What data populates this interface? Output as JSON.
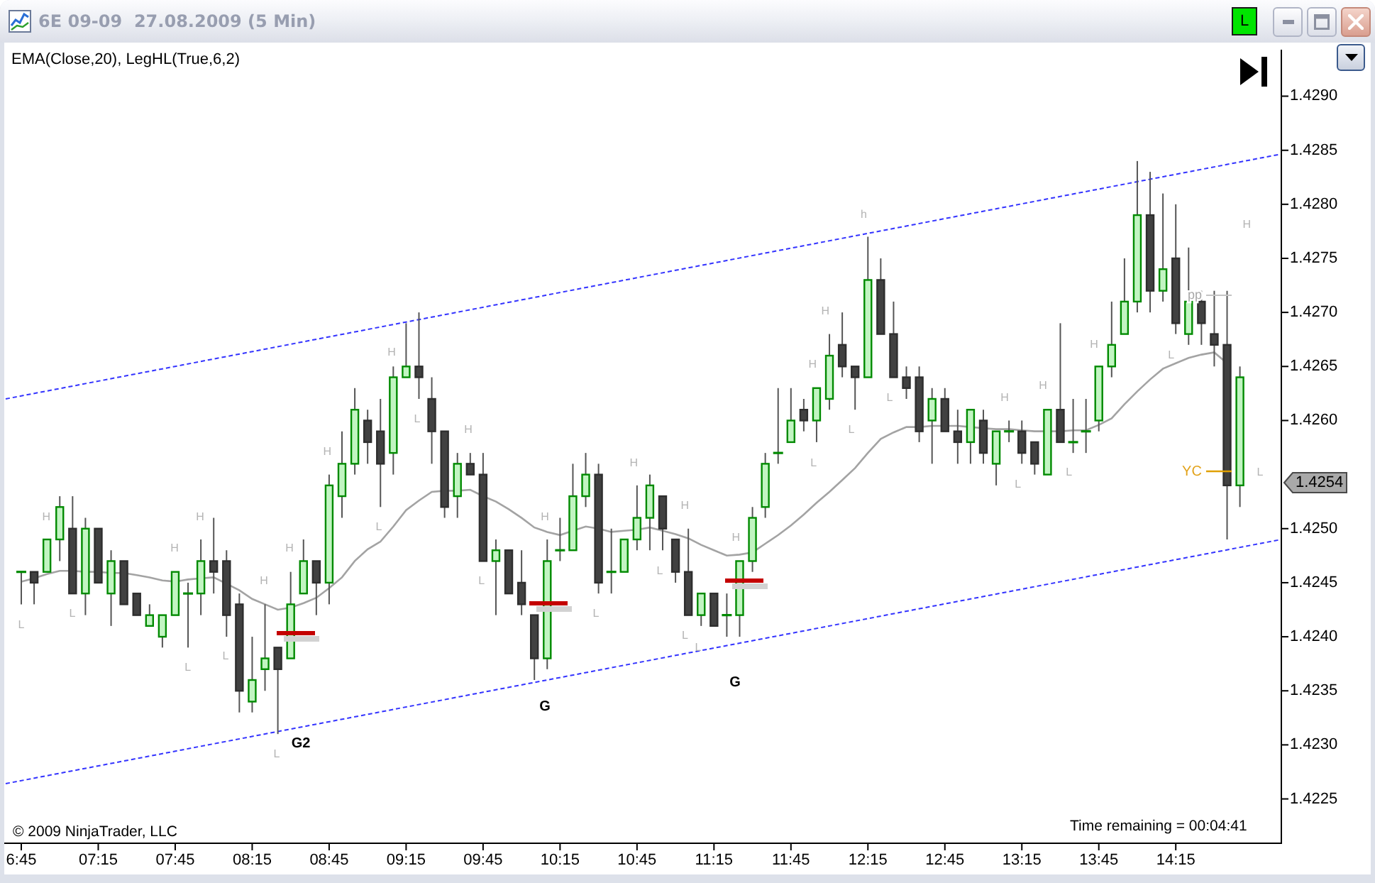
{
  "window": {
    "title": "6E 09-09  27.08.2009 (5 Min)",
    "status_badge": "L"
  },
  "chart": {
    "other_indicators": ", LegHL(True,6,2)",
    "leg_labels": [
      "L",
      "H",
      "L",
      "H",
      "L",
      "H",
      "L",
      "H",
      "L",
      "H",
      "H",
      "L",
      "H",
      "L",
      "H",
      "L",
      "H",
      "L",
      "H",
      "L",
      "H",
      "L",
      "L",
      "H",
      "H",
      "L",
      "H",
      "L",
      "h",
      "L",
      "H",
      "L",
      "H",
      "L",
      "H",
      "L",
      "H",
      "L"
    ],
    "signal_labels": [
      "G2",
      "G",
      "G"
    ],
    "yc_label": "YC",
    "pp_label": "pp",
    "last_price": "1.4254",
    "copyright": "© 2009 NinjaTrader, LLC",
    "time_remaining": "Time remaining = 00:04:41",
    "chart_data": {
      "type": "candlestick",
      "categories": [
        "6:45",
        null,
        null,
        null,
        null,
        null,
        "07:15",
        null,
        null,
        null,
        null,
        null,
        "07:45",
        null,
        null,
        null,
        null,
        null,
        "08:15",
        null,
        null,
        null,
        null,
        null,
        "08:45",
        null,
        null,
        null,
        null,
        null,
        "09:15",
        null,
        null,
        null,
        null,
        null,
        "09:45",
        null,
        null,
        null,
        null,
        null,
        "10:15",
        null,
        null,
        null,
        null,
        null,
        "10:45",
        null,
        null,
        null,
        null,
        null,
        "11:15",
        null,
        null,
        null,
        null,
        null,
        "11:45",
        null,
        null,
        null,
        null,
        null,
        "12:15",
        null,
        null,
        null,
        null,
        null,
        "12:45",
        null,
        null,
        null,
        null,
        null,
        "13:15",
        null,
        null,
        null,
        null,
        null,
        "13:45",
        null,
        null,
        null,
        null,
        null,
        "14:15",
        null,
        null,
        null,
        null,
        null
      ],
      "ohlc": [
        [
          1.4246,
          1.4246,
          1.4243,
          1.4246
        ],
        [
          1.4246,
          1.4246,
          1.4243,
          1.4245
        ],
        [
          1.4246,
          1.4249,
          1.4246,
          1.4249
        ],
        [
          1.4249,
          1.4253,
          1.4247,
          1.4252
        ],
        [
          1.425,
          1.4253,
          1.4244,
          1.4244
        ],
        [
          1.4244,
          1.4251,
          1.4242,
          1.425
        ],
        [
          1.425,
          1.425,
          1.4245,
          1.4245
        ],
        [
          1.4244,
          1.4248,
          1.4241,
          1.4247
        ],
        [
          1.4247,
          1.4247,
          1.4243,
          1.4243
        ],
        [
          1.4244,
          1.4244,
          1.4242,
          1.4242
        ],
        [
          1.4241,
          1.4243,
          1.4241,
          1.4242
        ],
        [
          1.424,
          1.4242,
          1.4239,
          1.4242
        ],
        [
          1.4242,
          1.4246,
          1.4242,
          1.4246
        ],
        [
          1.4244,
          1.4245,
          1.4239,
          1.4244
        ],
        [
          1.4244,
          1.4249,
          1.4242,
          1.4247
        ],
        [
          1.4247,
          1.4251,
          1.4244,
          1.4246
        ],
        [
          1.4247,
          1.4248,
          1.424,
          1.4242
        ],
        [
          1.4243,
          1.4244,
          1.4233,
          1.4235
        ],
        [
          1.4234,
          1.424,
          1.4233,
          1.4236
        ],
        [
          1.4237,
          1.4243,
          1.4235,
          1.4238
        ],
        [
          1.4239,
          1.4239,
          1.4231,
          1.4237
        ],
        [
          1.4238,
          1.4246,
          1.4238,
          1.4243
        ],
        [
          1.4244,
          1.4249,
          1.4244,
          1.4247
        ],
        [
          1.4247,
          1.4247,
          1.4242,
          1.4245
        ],
        [
          1.4245,
          1.4255,
          1.4243,
          1.4254
        ],
        [
          1.4253,
          1.4259,
          1.4251,
          1.4256
        ],
        [
          1.4256,
          1.4263,
          1.4255,
          1.4261
        ],
        [
          1.426,
          1.4261,
          1.4256,
          1.4258
        ],
        [
          1.4259,
          1.4262,
          1.4252,
          1.4256
        ],
        [
          1.4257,
          1.4265,
          1.4255,
          1.4264
        ],
        [
          1.4264,
          1.4269,
          1.4264,
          1.4265
        ],
        [
          1.4265,
          1.427,
          1.4262,
          1.4264
        ],
        [
          1.4262,
          1.4264,
          1.4256,
          1.4259
        ],
        [
          1.4259,
          1.4259,
          1.4251,
          1.4252
        ],
        [
          1.4253,
          1.4257,
          1.4251,
          1.4256
        ],
        [
          1.4256,
          1.4257,
          1.4255,
          1.4255
        ],
        [
          1.4255,
          1.4257,
          1.4247,
          1.4247
        ],
        [
          1.4247,
          1.4249,
          1.4242,
          1.4248
        ],
        [
          1.4248,
          1.4248,
          1.4244,
          1.4244
        ],
        [
          1.4245,
          1.4248,
          1.4242,
          1.4243
        ],
        [
          1.4242,
          1.4242,
          1.4236,
          1.4238
        ],
        [
          1.4238,
          1.4249,
          1.4237,
          1.4247
        ],
        [
          1.4248,
          1.4251,
          1.4247,
          1.4248
        ],
        [
          1.4248,
          1.4256,
          1.4248,
          1.4253
        ],
        [
          1.4253,
          1.4257,
          1.4252,
          1.4255
        ],
        [
          1.4255,
          1.4256,
          1.4244,
          1.4245
        ],
        [
          1.4246,
          1.425,
          1.4244,
          1.4246
        ],
        [
          1.4246,
          1.4249,
          1.4246,
          1.4249
        ],
        [
          1.4249,
          1.4254,
          1.4248,
          1.4251
        ],
        [
          1.4251,
          1.4255,
          1.4248,
          1.4254
        ],
        [
          1.4253,
          1.4253,
          1.4248,
          1.425
        ],
        [
          1.4249,
          1.4249,
          1.4245,
          1.4246
        ],
        [
          1.4246,
          1.425,
          1.4242,
          1.4242
        ],
        [
          1.4242,
          1.4244,
          1.4241,
          1.4244
        ],
        [
          1.4244,
          1.4244,
          1.4241,
          1.4241
        ],
        [
          1.4242,
          1.4244,
          1.424,
          1.4242
        ],
        [
          1.4242,
          1.4247,
          1.424,
          1.4247
        ],
        [
          1.4247,
          1.4252,
          1.4246,
          1.4251
        ],
        [
          1.4252,
          1.4257,
          1.4251,
          1.4256
        ],
        [
          1.4257,
          1.4263,
          1.4256,
          1.4257
        ],
        [
          1.4258,
          1.4263,
          1.4258,
          1.426
        ],
        [
          1.4261,
          1.4262,
          1.4259,
          1.426
        ],
        [
          1.426,
          1.4263,
          1.4258,
          1.4263
        ],
        [
          1.4262,
          1.4268,
          1.4261,
          1.4266
        ],
        [
          1.4267,
          1.427,
          1.4264,
          1.4265
        ],
        [
          1.4265,
          1.4265,
          1.4261,
          1.4264
        ],
        [
          1.4264,
          1.4277,
          1.4264,
          1.4273
        ],
        [
          1.4273,
          1.4275,
          1.4268,
          1.4268
        ],
        [
          1.4268,
          1.4271,
          1.4264,
          1.4264
        ],
        [
          1.4264,
          1.4265,
          1.4262,
          1.4263
        ],
        [
          1.4264,
          1.4265,
          1.4258,
          1.4259
        ],
        [
          1.426,
          1.4263,
          1.4256,
          1.4262
        ],
        [
          1.4262,
          1.4263,
          1.4259,
          1.4259
        ],
        [
          1.4259,
          1.4261,
          1.4256,
          1.4258
        ],
        [
          1.4258,
          1.4261,
          1.4256,
          1.4261
        ],
        [
          1.426,
          1.4261,
          1.4256,
          1.4257
        ],
        [
          1.4256,
          1.4259,
          1.4254,
          1.4259
        ],
        [
          1.4259,
          1.426,
          1.4258,
          1.4259
        ],
        [
          1.4259,
          1.426,
          1.4256,
          1.4257
        ],
        [
          1.4258,
          1.4258,
          1.4255,
          1.4256
        ],
        [
          1.4255,
          1.4261,
          1.4255,
          1.4261
        ],
        [
          1.4261,
          1.4269,
          1.4258,
          1.4258
        ],
        [
          1.4258,
          1.4262,
          1.4257,
          1.4258
        ],
        [
          1.4259,
          1.4262,
          1.4257,
          1.4259
        ],
        [
          1.426,
          1.4265,
          1.4259,
          1.4265
        ],
        [
          1.4265,
          1.4271,
          1.4264,
          1.4267
        ],
        [
          1.4268,
          1.4275,
          1.4268,
          1.4271
        ],
        [
          1.4271,
          1.4284,
          1.427,
          1.4279
        ],
        [
          1.4279,
          1.4283,
          1.427,
          1.4272
        ],
        [
          1.4272,
          1.4281,
          1.4271,
          1.4274
        ],
        [
          1.4275,
          1.428,
          1.4268,
          1.4269
        ],
        [
          1.4268,
          1.4276,
          1.4267,
          1.4271
        ],
        [
          1.4271,
          1.4272,
          1.4267,
          1.4269
        ],
        [
          1.4268,
          1.4272,
          1.4265,
          1.4267
        ],
        [
          1.4267,
          1.4272,
          1.4249,
          1.4254
        ],
        [
          1.4254,
          1.4265,
          1.4252,
          1.4264
        ]
      ],
      "series": [
        {
          "name": "EMA(Close,20)",
          "type": "line",
          "color": "#a3a3a3",
          "values": [
            1.42451,
            1.42454,
            1.42458,
            1.42461,
            1.42461,
            1.4246,
            1.4246,
            1.42459,
            1.42459,
            1.42457,
            1.42455,
            1.42452,
            1.42451,
            1.42453,
            1.42454,
            1.42455,
            1.42449,
            1.42443,
            1.42435,
            1.4243,
            1.42425,
            1.42427,
            1.42431,
            1.42436,
            1.42445,
            1.42455,
            1.4247,
            1.42481,
            1.42488,
            1.42502,
            1.42517,
            1.42526,
            1.42534,
            1.42535,
            1.42535,
            1.42536,
            1.4253,
            1.42525,
            1.42518,
            1.4251,
            1.42501,
            1.42497,
            1.42494,
            1.42498,
            1.42502,
            1.425,
            1.42497,
            1.42498,
            1.42499,
            1.42501,
            1.42498,
            1.42495,
            1.42491,
            1.42485,
            1.4248,
            1.42475,
            1.42476,
            1.42478,
            1.42486,
            1.42494,
            1.42503,
            1.42513,
            1.42524,
            1.42534,
            1.42545,
            1.42556,
            1.4257,
            1.42583,
            1.42589,
            1.42594,
            1.42594,
            1.42595,
            1.42595,
            1.42595,
            1.42594,
            1.42593,
            1.42592,
            1.42592,
            1.42591,
            1.4259,
            1.4259,
            1.4259,
            1.42591,
            1.42591,
            1.42596,
            1.42602,
            1.42615,
            1.42627,
            1.42638,
            1.42648,
            1.42653,
            1.42658,
            1.42661,
            1.42663,
            1.42653,
            null
          ]
        }
      ],
      "ylim": [
        1.42209,
        1.42943
      ],
      "yticks": [
        {
          "value": 1.429,
          "label": "1.4290"
        },
        {
          "value": 1.4285,
          "label": "1.4285"
        },
        {
          "value": 1.428,
          "label": "1.4280"
        },
        {
          "value": 1.4275,
          "label": "1.4275"
        },
        {
          "value": 1.427,
          "label": "1.4270"
        },
        {
          "value": 1.4265,
          "label": "1.4265"
        },
        {
          "value": 1.426,
          "label": "1.4260"
        },
        {
          "value": 1.425,
          "label": "1.4250"
        },
        {
          "value": 1.4245,
          "label": "1.4245"
        },
        {
          "value": 1.424,
          "label": "1.4240"
        },
        {
          "value": 1.4235,
          "label": "1.4235"
        },
        {
          "value": 1.423,
          "label": "1.4230"
        },
        {
          "value": 1.4225,
          "label": "1.4225"
        }
      ]
    }
  }
}
